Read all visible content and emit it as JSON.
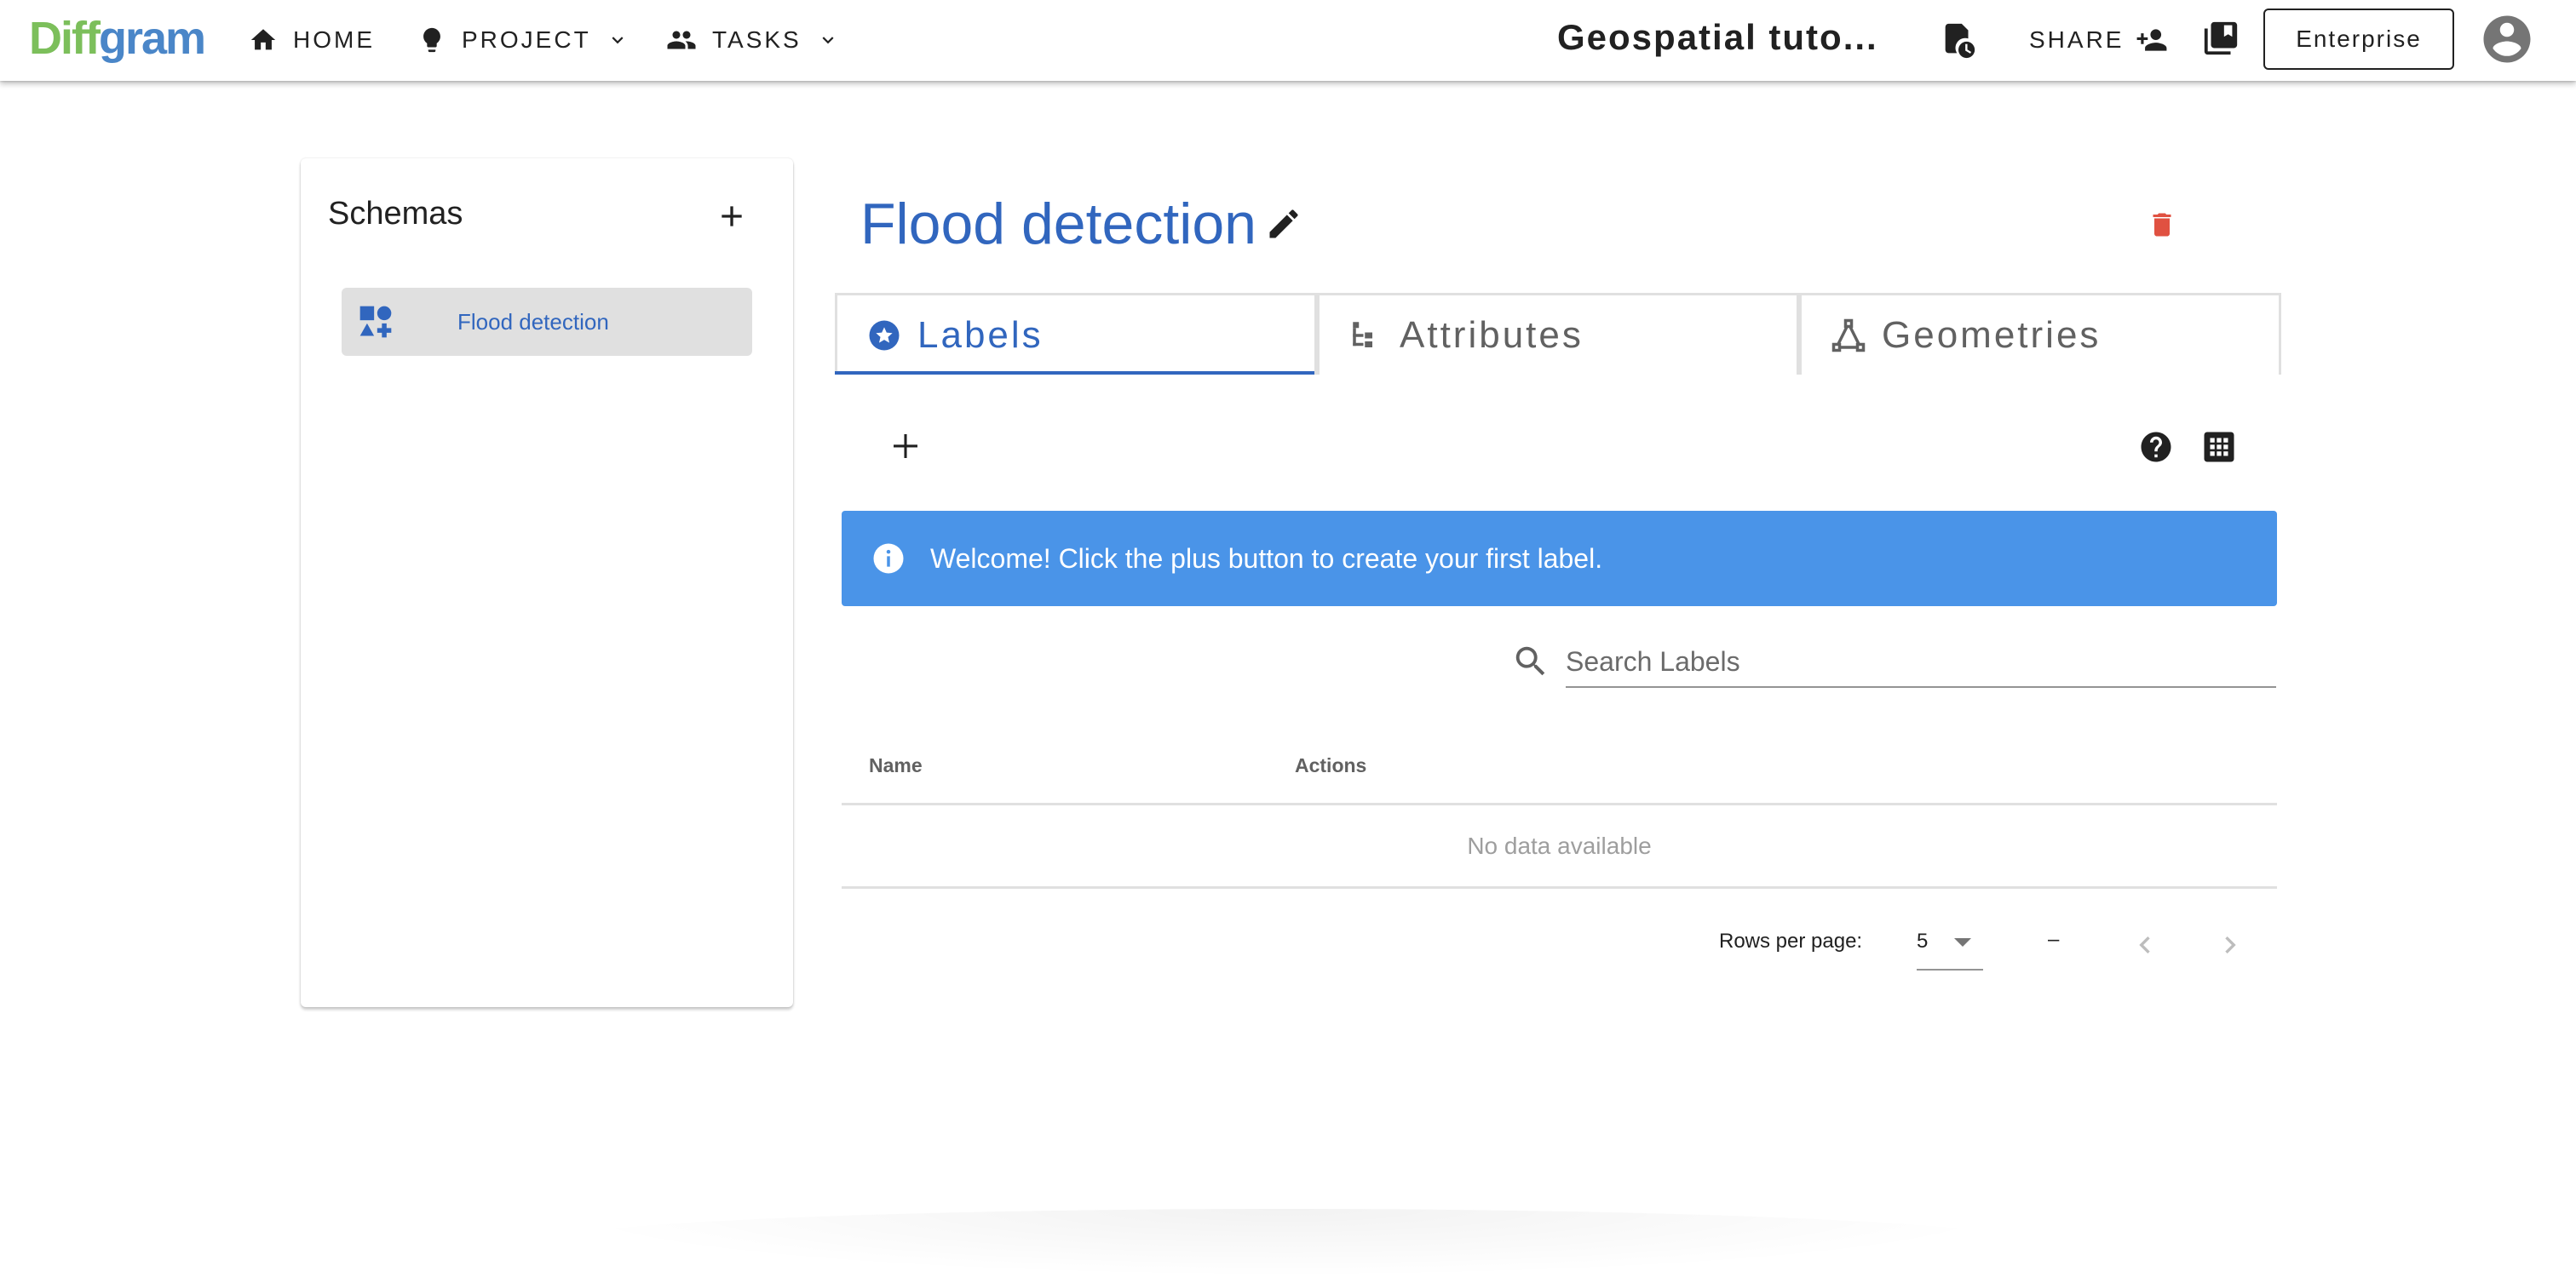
{
  "header": {
    "logo": {
      "part1": "Diff",
      "part2": "gram"
    },
    "nav": [
      {
        "label": "HOME",
        "icon": "home-icon"
      },
      {
        "label": "PROJECT",
        "icon": "lightbulb-icon",
        "has_dropdown": true
      },
      {
        "label": "TASKS",
        "icon": "people-icon",
        "has_dropdown": true
      }
    ],
    "project_title": "Geospatial tuto...",
    "share_label": "SHARE",
    "enterprise_label": "Enterprise"
  },
  "schemas": {
    "title": "Schemas",
    "items": [
      {
        "label": "Flood detection",
        "selected": true,
        "icon": "shapes-icon"
      }
    ]
  },
  "main": {
    "title": "Flood detection",
    "tabs": [
      {
        "label": "Labels",
        "icon": "star-circle-icon",
        "active": true
      },
      {
        "label": "Attributes",
        "icon": "tree-icon",
        "active": false
      },
      {
        "label": "Geometries",
        "icon": "vector-triangle-icon",
        "active": false
      }
    ],
    "alert": {
      "message": "Welcome! Click the plus button to create your first label."
    },
    "search": {
      "placeholder": "Search Labels",
      "value": ""
    },
    "table": {
      "columns": [
        "Name",
        "Actions"
      ],
      "rows": [],
      "empty_text": "No data available"
    },
    "pagination": {
      "rows_per_page_label": "Rows per page:",
      "rows_per_page": "5",
      "range": "–"
    }
  },
  "colors": {
    "primary": "#3166be",
    "alert_bg": "#4a94e8",
    "danger": "#e05141",
    "logo_green": "#7cbf5b",
    "logo_blue": "#4a86c8"
  }
}
